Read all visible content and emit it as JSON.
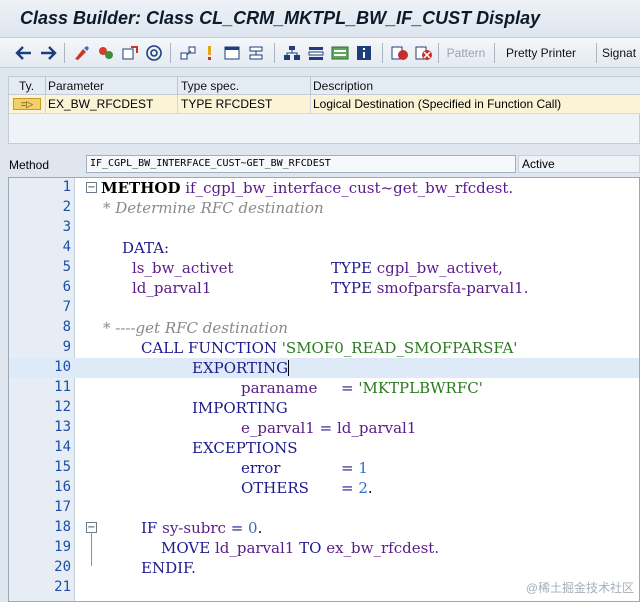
{
  "window": {
    "title": "Class Builder: Class CL_CRM_MKTPL_BW_IF_CUST Display"
  },
  "toolbar": {
    "pattern_label": "Pattern",
    "pretty_printer_label": "Pretty Printer",
    "signature_label": "Signat"
  },
  "params": {
    "headers": {
      "ty": "Ty.",
      "parameter": "Parameter",
      "type_spec": "Type spec.",
      "description": "Description"
    },
    "rows": [
      {
        "ty_icon": "exporting-param-icon",
        "parameter": "EX_BW_RFCDEST",
        "type_spec": "TYPE RFCDEST",
        "description": "Logical Destination (Specified in Function Call)"
      }
    ]
  },
  "method_bar": {
    "label": "Method",
    "value": "IF_CGPL_BW_INTERFACE_CUST~GET_BW_RFCDEST",
    "status": "Active"
  },
  "editor": {
    "line_numbers": [
      "1",
      "2",
      "3",
      "4",
      "5",
      "6",
      "7",
      "8",
      "9",
      "10",
      "11",
      "12",
      "13",
      "14",
      "15",
      "16",
      "17",
      "18",
      "19",
      "20",
      "21"
    ],
    "line1_kw": "METHOD",
    "line1_name": "if_cgpl_bw_interface_cust~get_bw_rfcdest.",
    "line2": "* Determine RFC destination",
    "line4": "DATA:",
    "line5_var": "ls_bw_activet",
    "line5_type_kw": "TYPE",
    "line5_type": "cgpl_bw_activet,",
    "line6_var": "ld_parval1",
    "line6_type_kw": "TYPE",
    "line6_type": "smofparsfa-parval1.",
    "line8": "* ----get RFC destination",
    "line9_kw": "CALL FUNCTION",
    "line9_str": "'SMOF0_READ_SMOFPARSFA'",
    "line10": "EXPORTING",
    "line11_name": "paraname",
    "line11_eq": "=",
    "line11_str": "'MKTPLBWRFC'",
    "line12": "IMPORTING",
    "line13_name": "e_parval1",
    "line13_eq": "=",
    "line13_val": "ld_parval1",
    "line14": "EXCEPTIONS",
    "line15_name": "error",
    "line15_eq": "=",
    "line15_num": "1",
    "line16_name": "OTHERS",
    "line16_eq": "=",
    "line16_num": "2",
    "line16_end": ".",
    "line18_kw": "IF",
    "line18_var": "sy-subrc",
    "line18_eq": "=",
    "line18_num": "0",
    "line18_end": ".",
    "line19_kw": "MOVE",
    "line19_var": "ld_parval1",
    "line19_to": "TO",
    "line19_dest": "ex_bw_rfcdest.",
    "line20": "ENDIF."
  },
  "watermark": "@稀土掘金技术社区"
}
